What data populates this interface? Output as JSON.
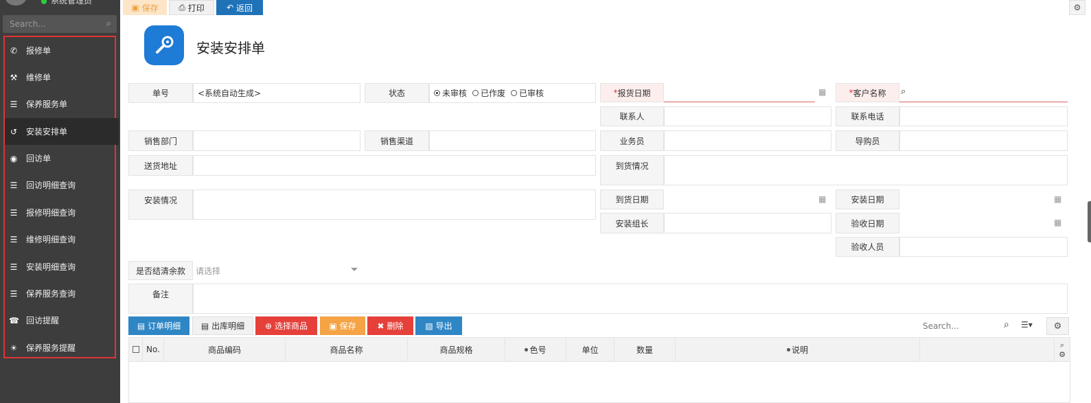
{
  "sidebar": {
    "user_name": "系统管理员",
    "search_placeholder": "Search...",
    "items": [
      {
        "label": "报修单",
        "icon": "phone-volume-icon"
      },
      {
        "label": "维修单",
        "icon": "tools-icon"
      },
      {
        "label": "保养服务单",
        "icon": "list-icon"
      },
      {
        "label": "安装安排单",
        "icon": "history-icon",
        "active": true
      },
      {
        "label": "回访单",
        "icon": "dot-circle-icon"
      },
      {
        "label": "回访明细查询",
        "icon": "list-ul-icon"
      },
      {
        "label": "报修明细查询",
        "icon": "list-ul-icon"
      },
      {
        "label": "维修明细查询",
        "icon": "list-icon"
      },
      {
        "label": "安装明细查询",
        "icon": "list-ol-icon"
      },
      {
        "label": "保养服务查询",
        "icon": "list-ol-icon"
      },
      {
        "label": "回访提醒",
        "icon": "phone-icon"
      },
      {
        "label": "保养服务提醒",
        "icon": "lightbulb-icon"
      }
    ]
  },
  "toolbar": {
    "save": "保存",
    "print": "打印",
    "back": "返回"
  },
  "header": {
    "title": "安装安排单",
    "icon": "wrench-icon"
  },
  "form": {
    "order_no_label": "单号",
    "order_no_value": "<系统自动生成>",
    "status_label": "状态",
    "status_options": [
      "未审核",
      "已作废",
      "已审核"
    ],
    "status_selected": "未审核",
    "report_date_label": "报货日期",
    "customer_label": "客户名称",
    "contact_label": "联系人",
    "phone_label": "联系电话",
    "dept_label": "销售部门",
    "channel_label": "销售渠道",
    "salesman_label": "业务员",
    "guide_label": "导购员",
    "address_label": "送货地址",
    "arrival_status_label": "到货情况",
    "install_status_label": "安装情况",
    "arrival_date_label": "到货日期",
    "install_date_label": "安装日期",
    "install_leader_label": "安装组长",
    "accept_date_label": "验收日期",
    "acceptor_label": "验收人员",
    "settle_label": "是否结清余款",
    "settle_placeholder": "请选择",
    "remark_label": "备注"
  },
  "grid_toolbar": {
    "order_detail": "订单明细",
    "out_detail": "出库明细",
    "choose_goods": "选择商品",
    "save": "保存",
    "delete": "删除",
    "export": "导出",
    "search_placeholder": "Search..."
  },
  "grid": {
    "columns": [
      "No.",
      "商品编码",
      "商品名称",
      "商品规格",
      "色号",
      "单位",
      "数量",
      "说明"
    ]
  },
  "colors": {
    "sidebar_bg": "#3d3d3d",
    "sidebar_border": "#e03434",
    "accent_blue": "#1f72b8",
    "danger_red": "#e6403a",
    "warning_orange": "#f4a345"
  }
}
